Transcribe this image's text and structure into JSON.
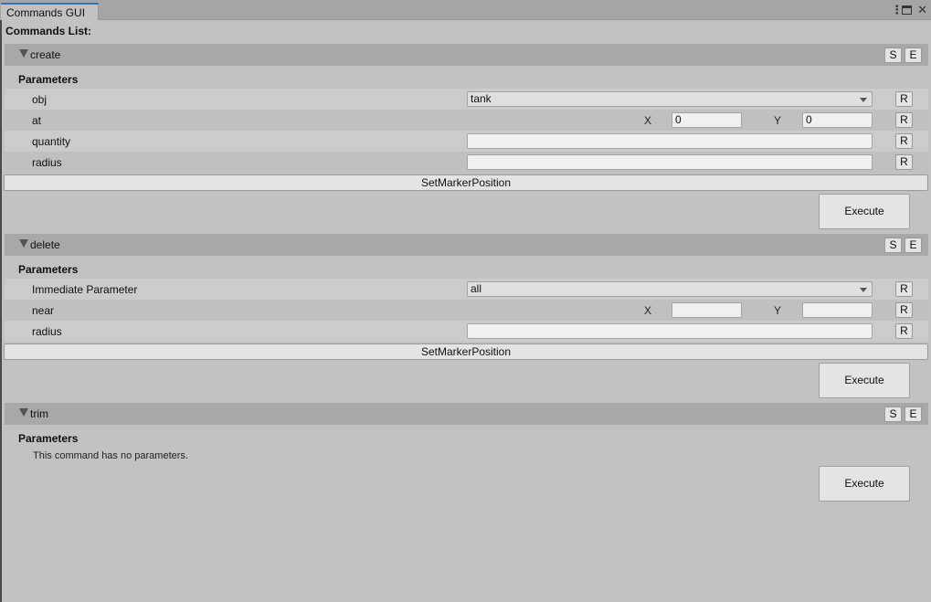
{
  "window": {
    "tab_title": "Commands GUI",
    "icons": [
      "menu-dots-icon",
      "maximize-icon",
      "close-icon"
    ],
    "accent_color": "#3a72b0"
  },
  "list_title": "Commands List:",
  "commands": [
    {
      "name": "create",
      "s_label": "S",
      "e_label": "E",
      "params_title": "Parameters",
      "params": [
        {
          "label": "obj",
          "type": "dropdown",
          "value": "tank",
          "reset_label": "R"
        },
        {
          "label": "at",
          "type": "vector2",
          "x_label": "X",
          "x_value": "0",
          "y_label": "Y",
          "y_value": "0",
          "reset_label": "R"
        },
        {
          "label": "quantity",
          "type": "text",
          "value": "",
          "reset_label": "R"
        },
        {
          "label": "radius",
          "type": "text",
          "value": "",
          "reset_label": "R"
        }
      ],
      "marker_button": "SetMarkerPosition",
      "execute_label": "Execute"
    },
    {
      "name": "delete",
      "s_label": "S",
      "e_label": "E",
      "params_title": "Parameters",
      "params": [
        {
          "label": "Immediate Parameter",
          "type": "dropdown",
          "value": "all",
          "reset_label": "R"
        },
        {
          "label": "near",
          "type": "vector2",
          "x_label": "X",
          "x_value": "",
          "y_label": "Y",
          "y_value": "",
          "reset_label": "R"
        },
        {
          "label": "radius",
          "type": "text",
          "value": "",
          "reset_label": "R"
        }
      ],
      "marker_button": "SetMarkerPosition",
      "execute_label": "Execute"
    },
    {
      "name": "trim",
      "s_label": "S",
      "e_label": "E",
      "params_title": "Parameters",
      "no_params_text": "This command has no parameters.",
      "execute_label": "Execute"
    }
  ]
}
